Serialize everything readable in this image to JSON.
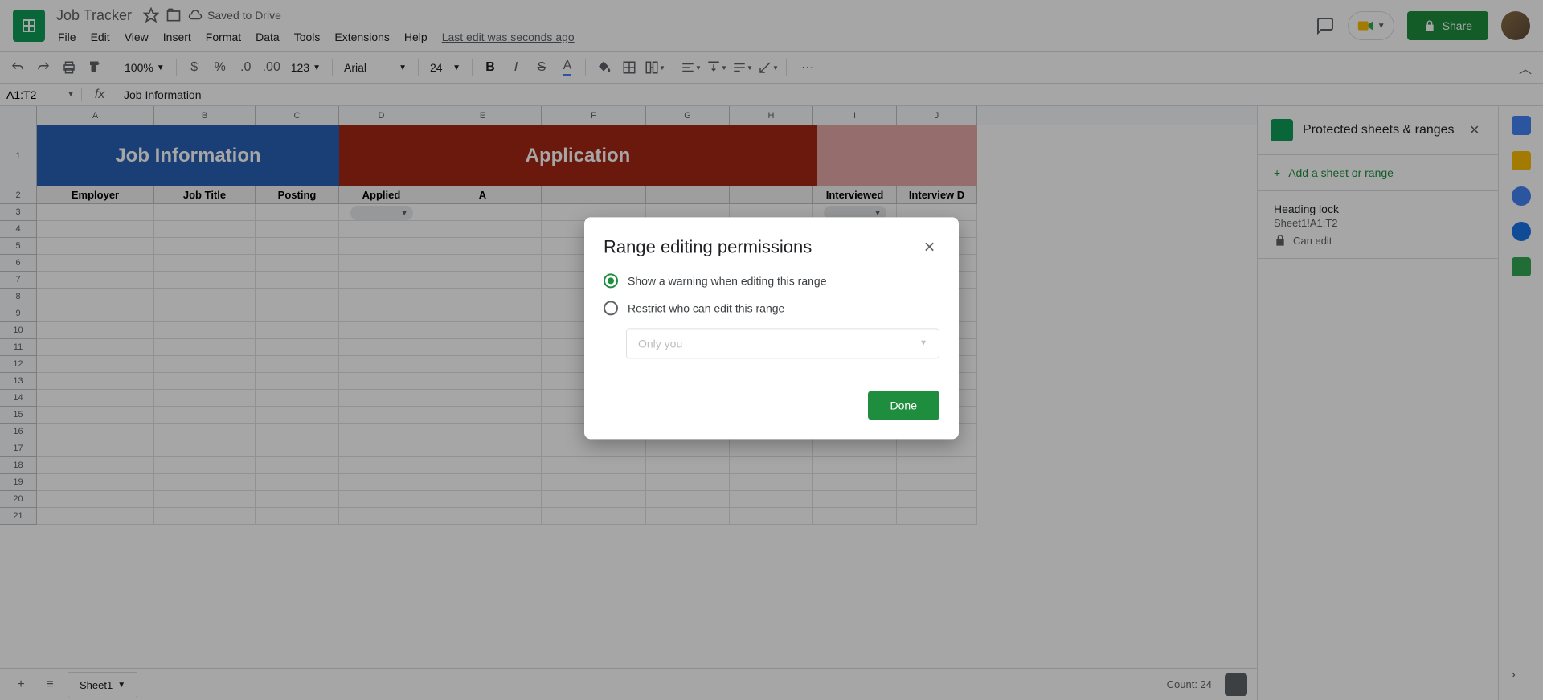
{
  "doc": {
    "title": "Job Tracker",
    "save_status": "Saved to Drive",
    "last_edit": "Last edit was seconds ago"
  },
  "menus": [
    "File",
    "Edit",
    "View",
    "Insert",
    "Format",
    "Data",
    "Tools",
    "Extensions",
    "Help"
  ],
  "toolbar": {
    "zoom": "100%",
    "font": "Arial",
    "size": "24",
    "format_num": "123"
  },
  "namebox": "A1:T2",
  "fx_value": "Job Information",
  "share_label": "Share",
  "columns": [
    "A",
    "B",
    "C",
    "D",
    "E",
    "F",
    "G",
    "H",
    "I",
    "J"
  ],
  "section_titles": {
    "job_info": "Job Information",
    "application": "Application"
  },
  "headers": [
    "Employer",
    "Job Title",
    "Posting",
    "Applied",
    "A",
    "",
    "",
    "",
    "Interviewed",
    "Interview D"
  ],
  "sidepanel": {
    "title": "Protected sheets & ranges",
    "add_label": "Add a sheet or range",
    "range": {
      "name": "Heading lock",
      "ref": "Sheet1!A1:T2",
      "perm": "Can edit"
    }
  },
  "sheet_tab": "Sheet1",
  "count_label": "Count: 24",
  "modal": {
    "title": "Range editing permissions",
    "opt_warn": "Show a warning when editing this range",
    "opt_restrict": "Restrict who can edit this range",
    "select_placeholder": "Only you",
    "done": "Done"
  }
}
